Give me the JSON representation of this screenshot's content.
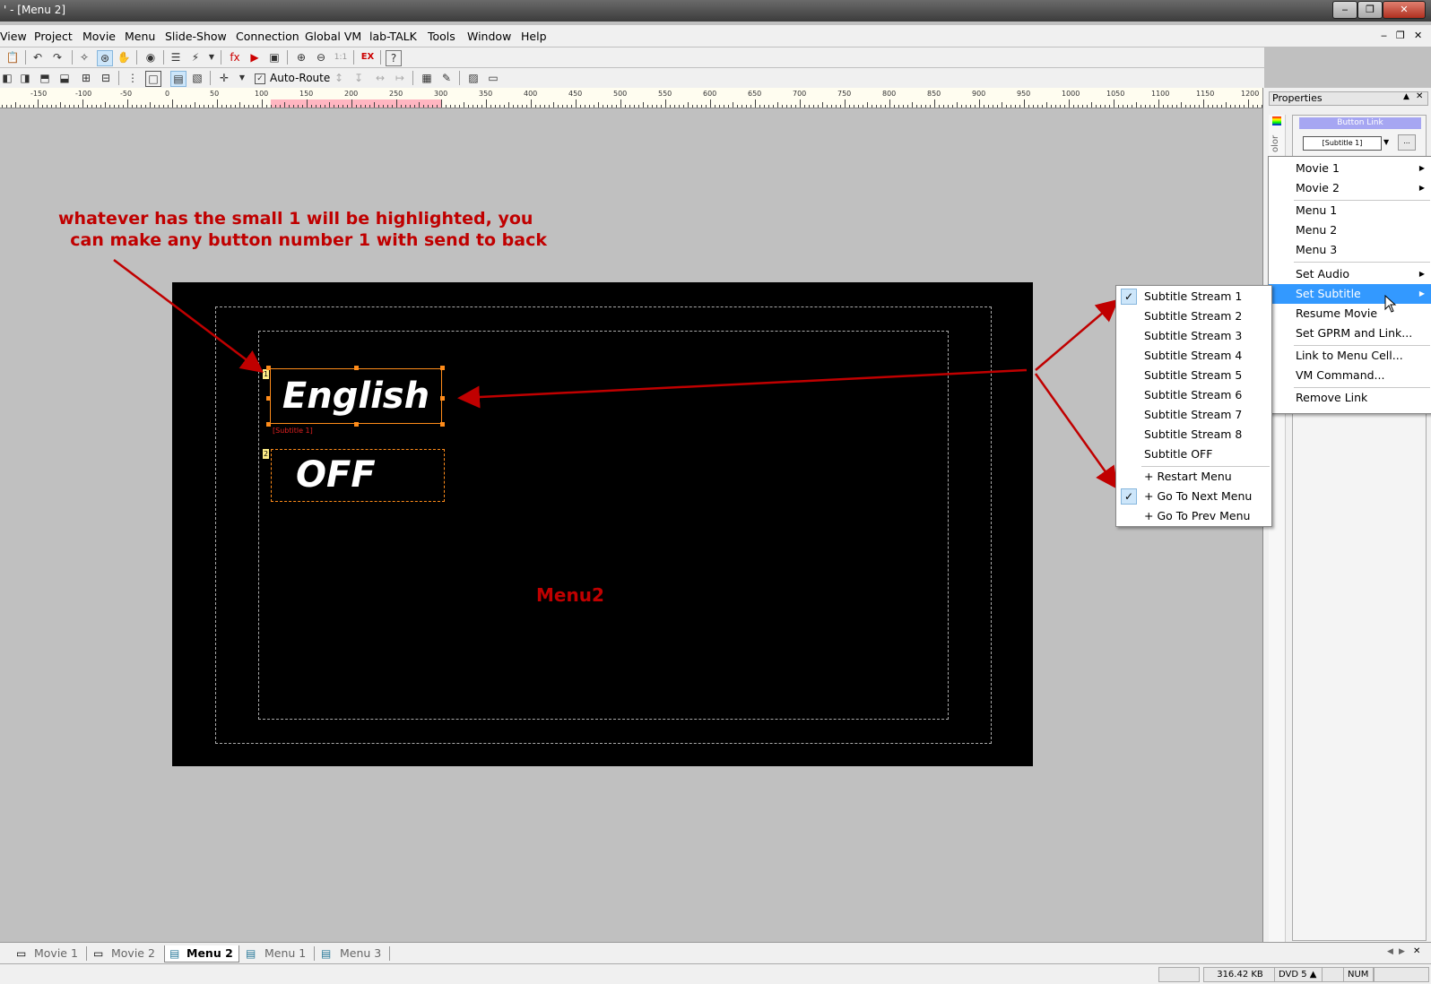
{
  "window": {
    "title": "' - [Menu 2]"
  },
  "menubar": [
    "View",
    "Project",
    "Movie",
    "Menu",
    "Slide-Show",
    "Connection",
    "Global VM",
    "lab-TALK",
    "Tools",
    "Window",
    "Help"
  ],
  "toolbar": {
    "auto_route_label": "Auto-Route"
  },
  "ruler": {
    "labels": [
      "-150",
      "-100",
      "-50",
      "0",
      "50",
      "100",
      "150",
      "200",
      "250",
      "300",
      "350",
      "400",
      "450",
      "500",
      "550",
      "600",
      "650",
      "700",
      "750",
      "800",
      "850",
      "900",
      "950",
      "1000",
      "1050",
      "1100",
      "1150",
      "1200"
    ]
  },
  "annotation": {
    "line1": "whatever has the small 1 will be highlighted, you",
    "line2": "  can make any button number 1 with send to back"
  },
  "menu_screen": {
    "buttons": [
      {
        "number": "1",
        "text": "English",
        "link_label": "[Subtitle 1]"
      },
      {
        "number": "2",
        "text": "OFF"
      }
    ],
    "name": "Menu2"
  },
  "properties": {
    "title": "Properties",
    "section": "Button Link",
    "link_value": "[Subtitle 1]",
    "side_label": "olor",
    "more_button": "..."
  },
  "link_menu": {
    "items": [
      {
        "label": "Movie 1",
        "submenu": true
      },
      {
        "label": "Movie 2",
        "submenu": true
      },
      {
        "label": "Menu 1"
      },
      {
        "label": "Menu 2"
      },
      {
        "label": "Menu 3"
      },
      {
        "label": "Set Audio",
        "submenu": true
      },
      {
        "label": "Set Subtitle",
        "submenu": true,
        "highlighted": true
      },
      {
        "label": "Resume Movie"
      },
      {
        "label": "Set GPRM and Link..."
      },
      {
        "label": "Link to Menu Cell..."
      },
      {
        "label": "VM Command..."
      },
      {
        "label": "Remove Link"
      }
    ]
  },
  "subtitle_menu": {
    "items": [
      {
        "label": "Subtitle Stream 1",
        "checked": true
      },
      {
        "label": "Subtitle Stream 2"
      },
      {
        "label": "Subtitle Stream 3"
      },
      {
        "label": "Subtitle Stream 4"
      },
      {
        "label": "Subtitle Stream 5"
      },
      {
        "label": "Subtitle Stream 6"
      },
      {
        "label": "Subtitle Stream 7"
      },
      {
        "label": "Subtitle Stream 8"
      },
      {
        "label": "Subtitle OFF"
      },
      {
        "label": "+ Restart Menu"
      },
      {
        "label": "+ Go To Next Menu",
        "checked": true
      },
      {
        "label": "+ Go To Prev Menu"
      }
    ]
  },
  "tabs": [
    "Movie 1",
    "Movie 2",
    "Menu 2",
    "Menu 1",
    "Menu 3"
  ],
  "active_tab": "Menu 2",
  "status": {
    "size": "316.42 KB",
    "disc": "DVD 5",
    "num": "NUM"
  },
  "colors": {
    "annotation": "#c00000",
    "highlight": "#3399ff",
    "selection": "#ff8c1a"
  }
}
